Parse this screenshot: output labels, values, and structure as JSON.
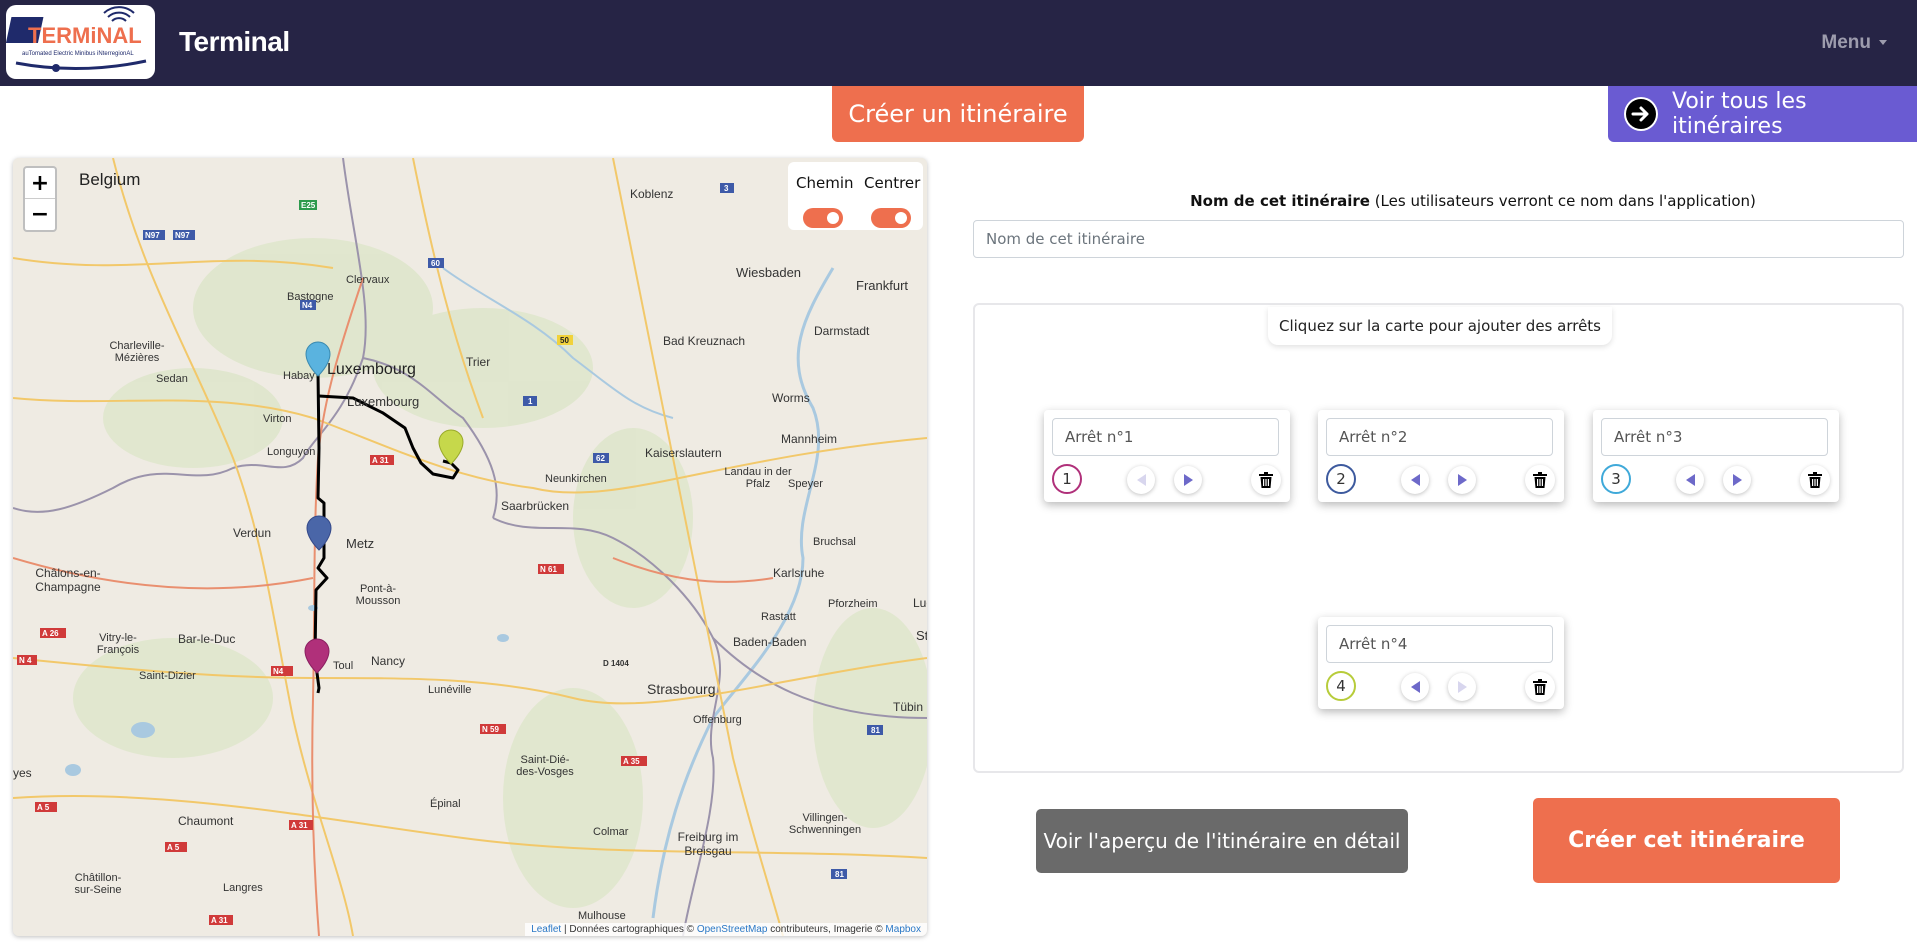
{
  "header": {
    "logo_text": "TERMiNAL",
    "logo_subtitle": "auTomated Electric Minibus iNterregionAL",
    "title": "Terminal",
    "menu_label": "Menu"
  },
  "tabs": {
    "create_label": "Créer un itinéraire",
    "view_all_label": "Voir tous les itinéraires"
  },
  "map": {
    "zoom_in": "+",
    "zoom_out": "−",
    "toggle_path_label": "Chemin",
    "toggle_center_label": "Centrer",
    "toggle_path_on": true,
    "toggle_center_on": true,
    "attribution": {
      "leaflet": "Leaflet",
      "sep": " | Données cartographiques © ",
      "osm": "OpenStreetMap",
      "contrib": " contributeurs, Imagerie © ",
      "mapbox": "Mapbox"
    },
    "labels": {
      "belgium": "Belgium",
      "luxembourg_country": "Luxembourg",
      "luxembourg_city": "Luxembourg",
      "koblenz": "Koblenz",
      "wiesbaden": "Wiesbaden",
      "frankfurt": "Frankfurt",
      "darmstadt": "Darmstadt",
      "bad_kreuznach": "Bad Kreuznach",
      "worms": "Worms",
      "mannheim": "Mannheim",
      "kaiserslautern": "Kaiserslautern",
      "neunkirchen": "Neunkirchen",
      "saarbrucken": "Saarbrücken",
      "speyer": "Speyer",
      "landau": "Landau in der Pfalz",
      "bruchsal": "Bruchsal",
      "karlsruhe": "Karlsruhe",
      "pforzheim": "Pforzheim",
      "rastatt": "Rastatt",
      "baden_baden": "Baden-Baden",
      "strasbourg": "Strasbourg",
      "offenburg": "Offenburg",
      "trier": "Trier",
      "clervaux": "Clervaux",
      "bastogne": "Bastogne",
      "charleville": "Charleville-Mézières",
      "sedan": "Sedan",
      "habay": "Habay",
      "virton": "Virton",
      "longuyon": "Longuyon",
      "verdun": "Verdun",
      "metz": "Metz",
      "pont_a_mousson": "Pont-à-Mousson",
      "chalons": "Châlons-en-Champagne",
      "vitry": "Vitry-le-François",
      "bar_le_duc": "Bar-le-Duc",
      "saint_dizier": "Saint-Dizier",
      "toul": "Toul",
      "nancy": "Nancy",
      "luneville": "Lunéville",
      "saint_die": "Saint-Dié-des-Vosges",
      "epinal": "Épinal",
      "chaumont": "Chaumont",
      "langres": "Langres",
      "chatillon": "Châtillon-sur-Seine",
      "colmar": "Colmar",
      "freiburg": "Freiburg im Breisgau",
      "villingen": "Villingen-Schwenningen",
      "mulhouse": "Mulhouse",
      "tubingen": "Tübin",
      "lud": "Lud",
      "st": "St",
      "yes": "yes"
    },
    "road_shields": {
      "e25": "E25",
      "n97a": "N97",
      "n97b": "N97",
      "n4_be": "N4",
      "r60": "60",
      "r3": "3",
      "r50": "50",
      "r1": "1",
      "r62": "62",
      "a31": "A 31",
      "n61": "N 61",
      "a26": "A 26",
      "n4": "N 4",
      "n4_fr": "N4",
      "d1404": "D 1404",
      "n59": "N 59",
      "a35": "A 35",
      "a5": "A 5",
      "a5b": "A 5",
      "a31b": "A 31",
      "a31c": "A 31",
      "r81": "81",
      "r81b": "81"
    }
  },
  "form": {
    "name_label_bold": "Nom de cet itinéraire",
    "name_label_rest": " (Les utilisateurs verront ce nom dans l'application)",
    "name_placeholder": "Nom de cet itinéraire",
    "stops_hint": "Cliquez sur la carte pour ajouter des arrêts",
    "stops": [
      {
        "placeholder": "Arrêt n°1",
        "number": "1",
        "color": "#b0307a",
        "prev_enabled": false,
        "next_enabled": true
      },
      {
        "placeholder": "Arrêt n°2",
        "number": "2",
        "color": "#3d5a9e",
        "prev_enabled": true,
        "next_enabled": true
      },
      {
        "placeholder": "Arrêt n°3",
        "number": "3",
        "color": "#3fa9d9",
        "prev_enabled": true,
        "next_enabled": true
      },
      {
        "placeholder": "Arrêt n°4",
        "number": "4",
        "color": "#b7cc3a",
        "prev_enabled": true,
        "next_enabled": false
      }
    ],
    "preview_button": "Voir l'aperçu de l'itinéraire en détail",
    "create_button": "Créer cet itinéraire"
  },
  "colors": {
    "navbar": "#262445",
    "accent_orange": "#ee6f4e",
    "accent_purple": "#6a5bd2",
    "preview_gray": "#6a6a6a"
  }
}
